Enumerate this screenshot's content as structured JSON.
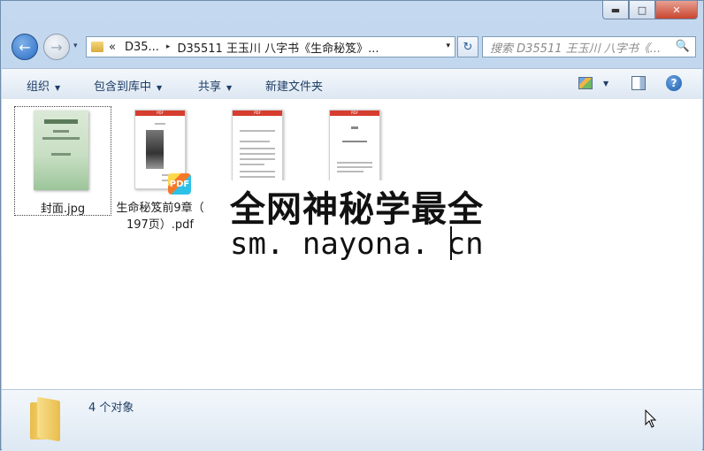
{
  "window": {
    "min_label": "▬",
    "max_label": "□",
    "close_label": "✕"
  },
  "nav": {
    "back_glyph": "←",
    "fwd_glyph": "→",
    "history_glyph": "▾",
    "breadcrumb_prefix": "«",
    "crumb1": "D35...",
    "crumb_sep": "▸",
    "crumb2": "D35511 王玉川 八字书《生命秘笈》...",
    "address_drop": "▾",
    "refresh_glyph": "↻",
    "search_placeholder": "搜索 D35511 王玉川 八字书《...",
    "search_glyph": "🔍"
  },
  "toolbar": {
    "organize": "组织",
    "include_library": "包含到库中",
    "share": "共享",
    "new_folder": "新建文件夹",
    "dropdown_glyph": "▼",
    "help_glyph": "?"
  },
  "files": [
    {
      "name": "封面.jpg",
      "type": "jpg"
    },
    {
      "name": "生命秘笈前9章（197页）.pdf",
      "name_line1": "生命秘笈前9章（",
      "name_line2": "197页）.pdf",
      "type": "pdf"
    },
    {
      "name": "",
      "type": "pdf"
    },
    {
      "name": "",
      "type": "pdf"
    }
  ],
  "thumbs": {
    "pdf_band": "PDF",
    "pdf_badge": "PDF"
  },
  "watermark": {
    "line1": "全网神秘学最全",
    "line2": "sm. nayona. cn"
  },
  "status": {
    "count_text": "4 个对象"
  }
}
